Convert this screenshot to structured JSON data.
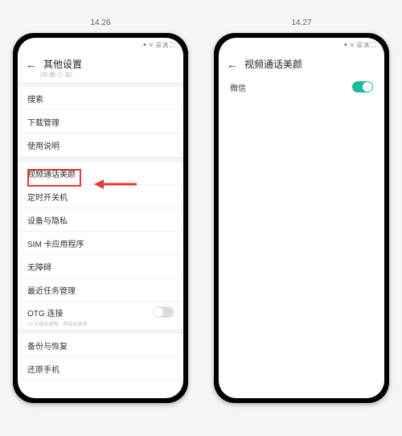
{
  "left_phone": {
    "external_time": "14.26",
    "statusbar": "✦ ᯤ 沼 洸 ▢",
    "header_title": "其他设置",
    "header_sub": "(中·南·三·谷)",
    "items": {
      "search": "搜索",
      "download": "下载管理",
      "instructions": "使用说明",
      "video_beauty": "视频通话美颜",
      "scheduled_power": "定时开关机",
      "device_privacy": "设备与隐私",
      "sim_app": "SIM 卡应用程序",
      "accessibility": "无障碍",
      "recent_tasks": "最近任务管理",
      "otg": "OTG 连接",
      "otg_sub": "10 分钟未使用，将自动关闭",
      "backup": "备份与恢复",
      "reset": "还原手机"
    }
  },
  "right_phone": {
    "external_time": "14.27",
    "statusbar": "✦ ᯤ 沼 洸 ▢",
    "header_title": "视频通话美颜",
    "item_wechat": "微信"
  }
}
